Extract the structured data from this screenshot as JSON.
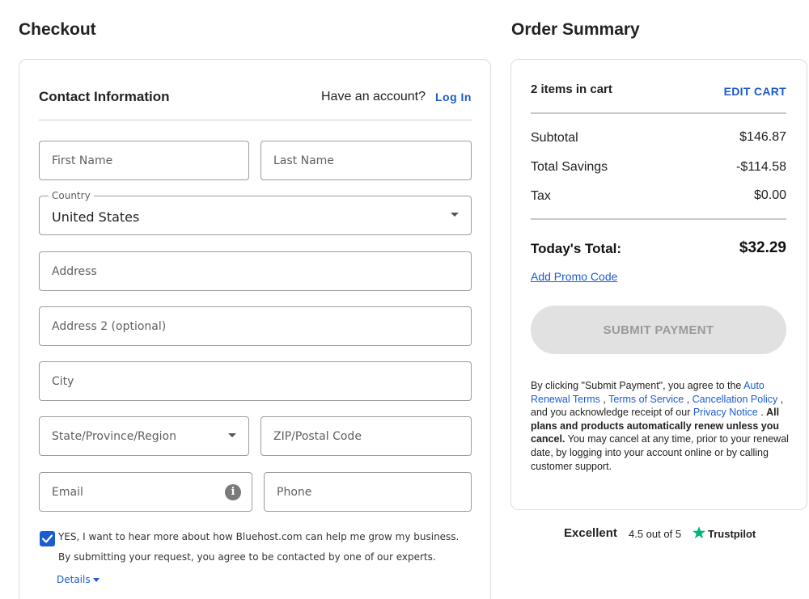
{
  "checkout": {
    "title": "Checkout",
    "contact": {
      "title": "Contact Information",
      "account_prompt": "Have an account?",
      "login_label": "Log In"
    },
    "fields": {
      "first_name_placeholder": "First Name",
      "last_name_placeholder": "Last Name",
      "country_label": "Country",
      "country_value": "United States",
      "address_placeholder": "Address",
      "address2_placeholder": "Address 2 (optional)",
      "city_placeholder": "City",
      "state_placeholder": "State/Province/Region",
      "zip_placeholder": "ZIP/Postal Code",
      "email_placeholder": "Email",
      "phone_placeholder": "Phone"
    },
    "optin": {
      "checked": true,
      "label": "YES, I want to hear more about how Bluehost.com can help me grow my business.",
      "consent": "By submitting your request, you agree to be contacted by one of our experts.",
      "details_label": "Details"
    }
  },
  "summary": {
    "title": "Order Summary",
    "items_count": "2 items in cart",
    "edit_cart_label": "EDIT CART",
    "subtotal_label": "Subtotal",
    "subtotal_value": "$146.87",
    "savings_label": "Total Savings",
    "savings_value": "-$114.58",
    "tax_label": "Tax",
    "tax_value": "$0.00",
    "total_label": "Today's Total:",
    "total_value": "$32.29",
    "promo_label": "Add Promo Code",
    "submit_label": "SUBMIT PAYMENT",
    "legal": {
      "intro": " By clicking \"Submit Payment\", you agree to the ",
      "auto_renewal_link": "Auto Renewal Terms",
      "sep1": " , ",
      "tos_link": "Terms of Service",
      "sep2": " , ",
      "cancellation_link": "Cancellation Policy",
      "acknowledge": " , and you acknowledge receipt of our ",
      "privacy_link": "Privacy Notice",
      "period": " . ",
      "bold_text": "All plans and products automatically renew unless you cancel.",
      "rest": " You may cancel at any time, prior to your renewal date, by logging into your account online or by calling customer support."
    }
  },
  "trustpilot": {
    "excellent": "Excellent",
    "rating": "4.5 out of 5",
    "brand": "Trustpilot",
    "star_color": "#00b67a"
  },
  "colors": {
    "accent": "#1b5bd0",
    "disabled_button": "#e1e1e1"
  }
}
